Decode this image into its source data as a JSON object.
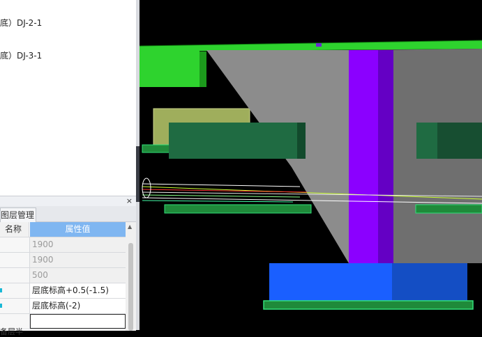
{
  "tree": {
    "items": [
      {
        "label": "底）DJ-2-1"
      },
      {
        "label": "底）DJ-3-1"
      }
    ]
  },
  "properties_panel": {
    "close_glyph": "×",
    "tabs": [
      {
        "label": "图层管理"
      }
    ],
    "columns": {
      "name": "名称",
      "value": "属性值"
    },
    "rows": [
      {
        "value": "1900",
        "readonly": true
      },
      {
        "value": "1900",
        "readonly": true
      },
      {
        "value": "500",
        "readonly": true
      },
      {
        "value": "层底标高+0.5(-1.5)",
        "readonly": false
      },
      {
        "value": "层底标高(-2)",
        "readonly": false
      },
      {
        "value": "",
        "readonly": false
      }
    ],
    "partial_row_name": "备层半"
  },
  "viewport": {
    "description_colors": {
      "background": "#000000",
      "slab": "#2ed32e",
      "pile_cap": "#8c8c8c",
      "column": "#8b00ff",
      "beam": "#1f6b42",
      "footing": "#1a5fff"
    }
  }
}
